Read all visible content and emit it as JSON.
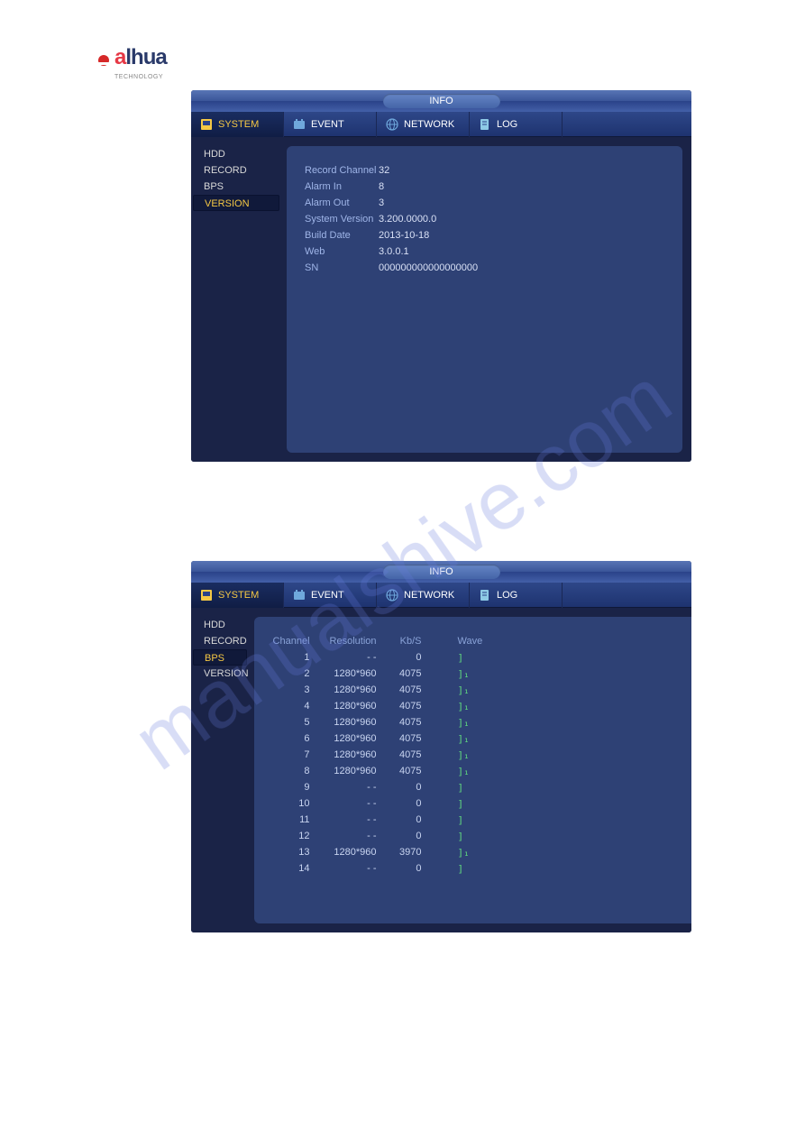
{
  "logo": {
    "brand_prefix": "a",
    "brand_rest": "lhua",
    "subtext": "TECHNOLOGY"
  },
  "title": "INFO",
  "tabs": [
    {
      "label": "SYSTEM"
    },
    {
      "label": "EVENT"
    },
    {
      "label": "NETWORK"
    },
    {
      "label": "LOG"
    }
  ],
  "window1": {
    "sidebar": [
      {
        "label": "HDD"
      },
      {
        "label": "RECORD"
      },
      {
        "label": "BPS"
      },
      {
        "label": "VERSION"
      }
    ],
    "selected": "VERSION",
    "info": [
      {
        "label": "Record Channel",
        "value": "32"
      },
      {
        "label": "Alarm In",
        "value": "8"
      },
      {
        "label": "Alarm Out",
        "value": "3"
      },
      {
        "label": "System Version",
        "value": "3.200.0000.0"
      },
      {
        "label": "Build Date",
        "value": "2013-10-18"
      },
      {
        "label": "Web",
        "value": "3.0.0.1"
      },
      {
        "label": "SN",
        "value": "000000000000000000"
      }
    ]
  },
  "window2": {
    "sidebar": [
      {
        "label": "HDD"
      },
      {
        "label": "RECORD"
      },
      {
        "label": "BPS"
      },
      {
        "label": "VERSION"
      }
    ],
    "selected": "BPS",
    "headers": {
      "channel": "Channel",
      "resolution": "Resolution",
      "kbs": "Kb/S",
      "wave": "Wave"
    },
    "rows": [
      {
        "ch": "1",
        "res": "- -",
        "kbs": "0",
        "wave": "]",
        "wave_end": "["
      },
      {
        "ch": "2",
        "res": "1280*960",
        "kbs": "4075",
        "wave": "]₁",
        "wave_end": "["
      },
      {
        "ch": "3",
        "res": "1280*960",
        "kbs": "4075",
        "wave": "]₁",
        "wave_end": "["
      },
      {
        "ch": "4",
        "res": "1280*960",
        "kbs": "4075",
        "wave": "]₁",
        "wave_end": "["
      },
      {
        "ch": "5",
        "res": "1280*960",
        "kbs": "4075",
        "wave": "]₁",
        "wave_end": "["
      },
      {
        "ch": "6",
        "res": "1280*960",
        "kbs": "4075",
        "wave": "]₁",
        "wave_end": "["
      },
      {
        "ch": "7",
        "res": "1280*960",
        "kbs": "4075",
        "wave": "]₁",
        "wave_end": "["
      },
      {
        "ch": "8",
        "res": "1280*960",
        "kbs": "4075",
        "wave": "]₁",
        "wave_end": "["
      },
      {
        "ch": "9",
        "res": "- -",
        "kbs": "0",
        "wave": "]",
        "wave_end": "["
      },
      {
        "ch": "10",
        "res": "- -",
        "kbs": "0",
        "wave": "]",
        "wave_end": "["
      },
      {
        "ch": "11",
        "res": "- -",
        "kbs": "0",
        "wave": "]",
        "wave_end": "["
      },
      {
        "ch": "12",
        "res": "- -",
        "kbs": "0",
        "wave": "]",
        "wave_end": "["
      },
      {
        "ch": "13",
        "res": "1280*960",
        "kbs": "3970",
        "wave": "]₁",
        "wave_end": "["
      },
      {
        "ch": "14",
        "res": "- -",
        "kbs": "0",
        "wave": "]",
        "wave_end": "["
      }
    ]
  },
  "watermark": "manualshive.com"
}
